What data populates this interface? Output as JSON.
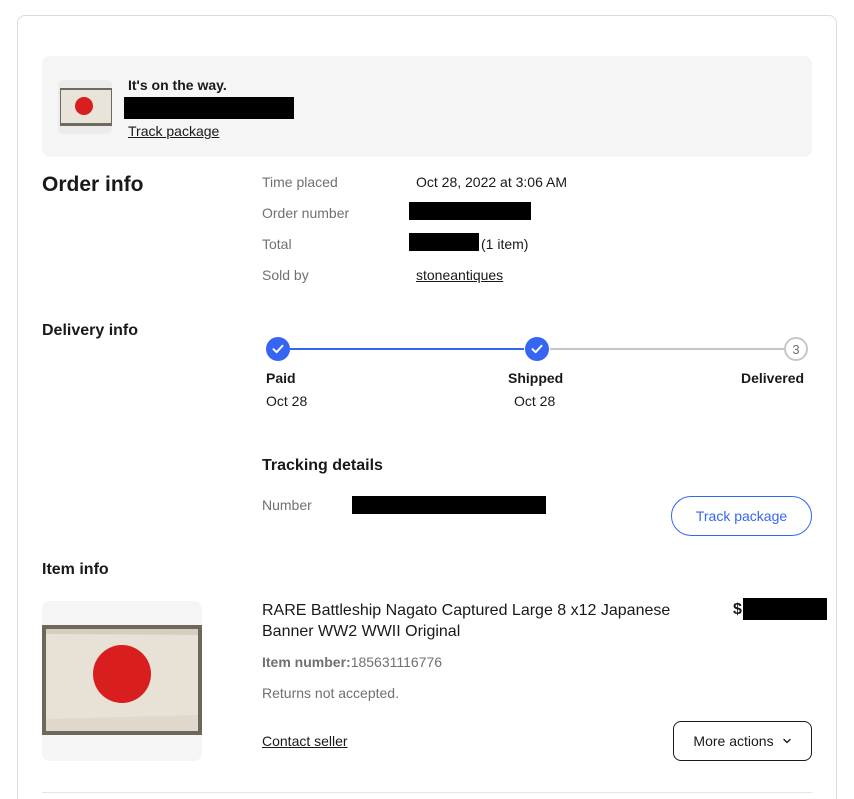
{
  "banner": {
    "status": "It's on the way.",
    "track_label": "Track package"
  },
  "order_info": {
    "heading": "Order info",
    "rows": [
      {
        "label": "Time placed",
        "value": "Oct 28, 2022 at 3:06 AM"
      },
      {
        "label": "Order number",
        "value": ""
      },
      {
        "label": "Total",
        "value": "(1 item)"
      },
      {
        "label": "Sold by",
        "value": "stoneantiques"
      }
    ]
  },
  "delivery_info": {
    "heading": "Delivery info",
    "steps": [
      {
        "label": "Paid",
        "date": "Oct 28",
        "state": "done"
      },
      {
        "label": "Shipped",
        "date": "Oct 28",
        "state": "done"
      },
      {
        "label": "Delivered",
        "date": "",
        "state": "pending",
        "number": "3"
      }
    ],
    "tracking": {
      "heading": "Tracking details",
      "number_label": "Number",
      "track_button": "Track package"
    }
  },
  "item_info": {
    "heading": "Item info",
    "title": "RARE Battleship Nagato Captured Large 8 x12 Japanese Banner WW2 WWII Original",
    "price_prefix": "$",
    "item_number_label": "Item number:",
    "item_number": "185631116776",
    "returns": "Returns not accepted.",
    "contact_label": "Contact seller",
    "more_actions_label": "More actions"
  },
  "colors": {
    "accent": "#3665f3",
    "flag_red": "#d81e1e",
    "pending_grey": "#c7c7c7"
  }
}
